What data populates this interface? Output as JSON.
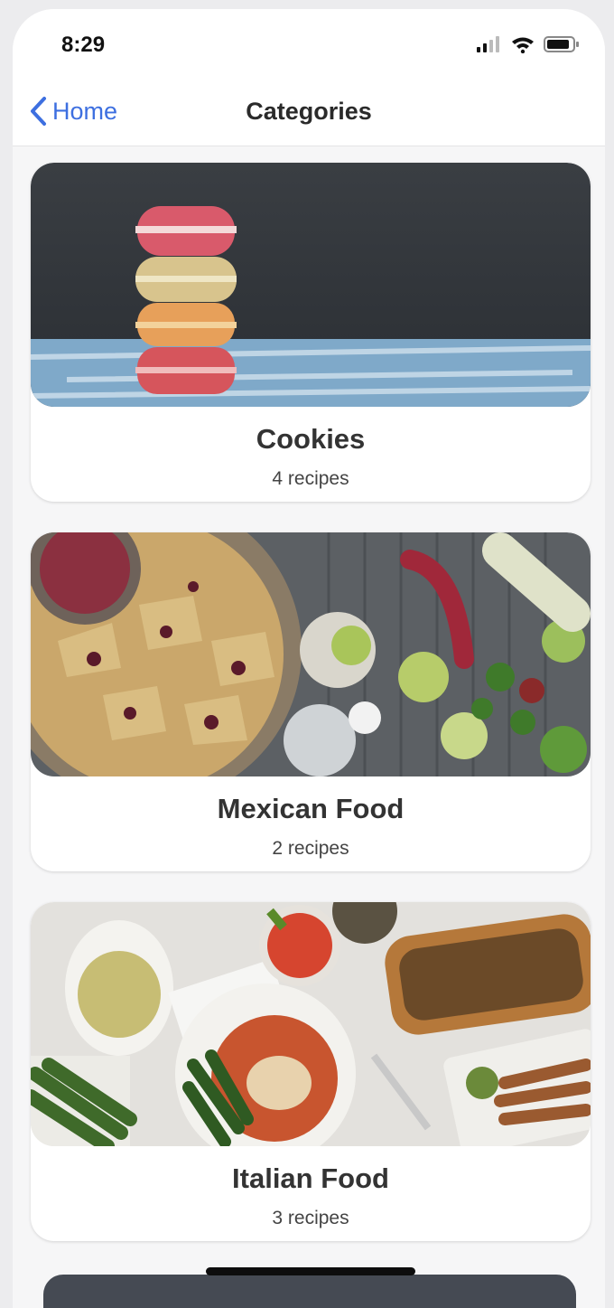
{
  "status_bar": {
    "time": "8:29",
    "icons": [
      "signal-icon",
      "wifi-icon",
      "battery-icon"
    ]
  },
  "nav": {
    "back_label": "Home",
    "title": "Categories"
  },
  "colors": {
    "accent": "#3d6fe0",
    "background": "#f6f6f7"
  },
  "categories": [
    {
      "name": "Cookies",
      "count": "4 recipes"
    },
    {
      "name": "Mexican Food",
      "count": "2 recipes"
    },
    {
      "name": "Italian Food",
      "count": "3 recipes"
    }
  ]
}
